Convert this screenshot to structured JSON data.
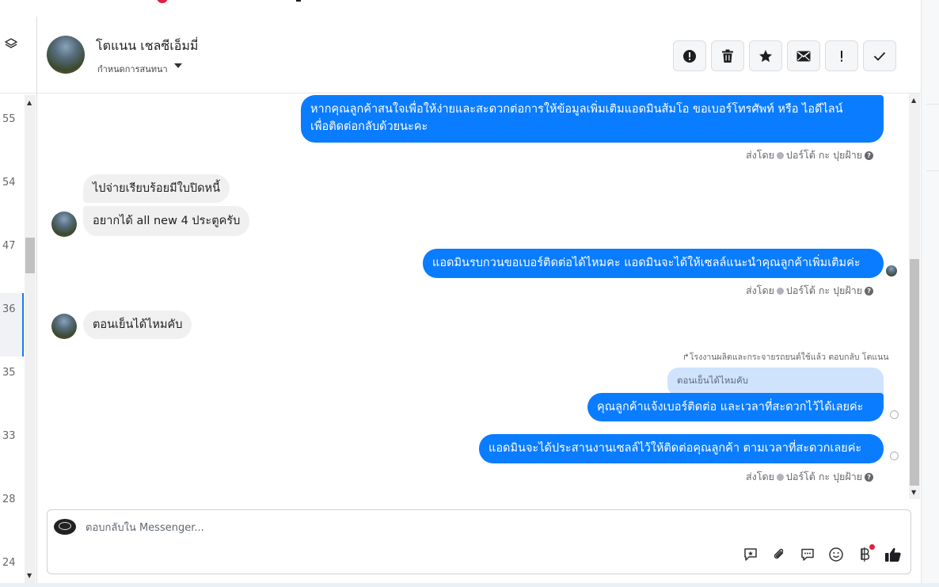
{
  "conversation": {
    "contact_name": "โตแนน เชลซีเอ็มมี่",
    "assign_label": "กำหนดการสนทนา"
  },
  "left_rail": {
    "items": [
      "55",
      "54",
      "47",
      "36",
      "35",
      "33",
      "28",
      "24"
    ]
  },
  "header_actions": [
    {
      "icon": "alert-circle-icon"
    },
    {
      "icon": "trash-icon"
    },
    {
      "icon": "star-icon"
    },
    {
      "icon": "envelope-icon"
    },
    {
      "icon": "exclamation-icon"
    },
    {
      "icon": "check-icon"
    }
  ],
  "messages": {
    "m1_line1": "หากคุณลูกค้าสนใจเพื่อให้ง่ายและสะดวกต่อการให้ข้อมูลเพิ่มเติมแอดมินส้มโอ ขอเบอร์โทรศัพท์ หรือ ไอดีไลน์",
    "m1_line2": "เพื่อติดต่อกลับด้วยนะคะ",
    "m2": "ไปจ่ายเรียบร้อยมีใบปิดหนี้",
    "m3": "อยากได้ all new 4 ประตูครับ",
    "m4": "แอดมินรบกวนขอเบอร์ติดต่อได้ไหมคะ แอดมินจะได้ให้เซลล์แนะนำคุณลูกค้าเพิ่มเติมค่ะ",
    "m5": "ตอนเย็นได้ไหมคับ",
    "reply_context": "โรงงานผลิตและกระจายรถยนต์ใช้แล้ว ตอบกลับ โตแนน",
    "quoted": "ตอนเย็นได้ไหมคับ",
    "m6": "คุณลูกค้าแจ้งเบอร์ติดต่อ และเวลาที่สะดวกไว้ได้เลยค่ะ",
    "m7": "แอดมินจะได้ประสานงานเซลล์ไว้ให้ติดต่อคุณลูกค้า ตามเวลาที่สะดวกเลยค่ะ"
  },
  "sent_by": {
    "prefix": "ส่งโดย",
    "agent": "ปอร์โต้ กะ ปุยฝ้าย"
  },
  "composer": {
    "placeholder": "ตอบกลับใน Messenger...",
    "value": "",
    "tools": [
      "saved-reply-icon",
      "attachment-icon",
      "chat-bubble-icon",
      "emoji-icon",
      "baht-payment-icon",
      "thumbs-up-icon"
    ]
  },
  "colors": {
    "outgoing_bubble": "#0a7cff",
    "incoming_bubble": "#f0f0f0",
    "notification_dot": "#e41e3f"
  }
}
